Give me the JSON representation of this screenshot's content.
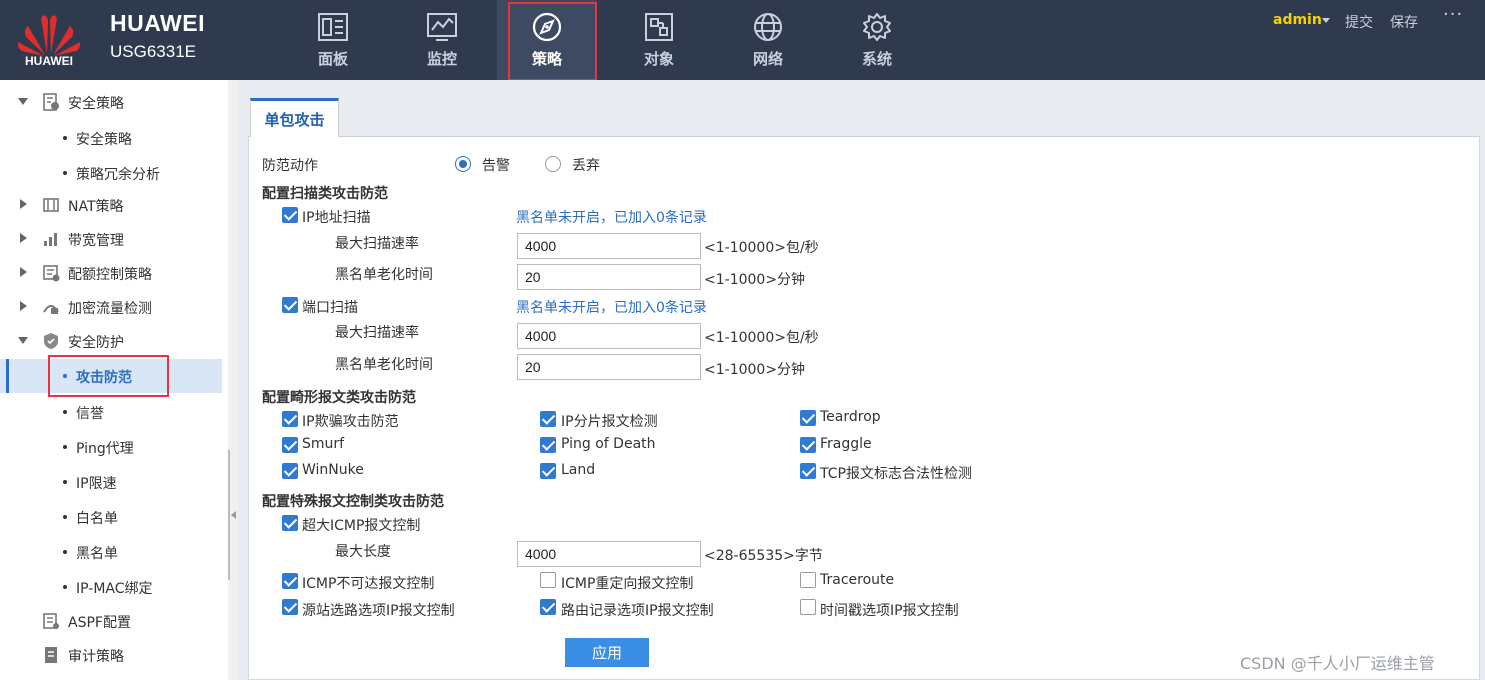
{
  "header": {
    "brand": "HUAWEI",
    "model": "USG6331E",
    "logo_text": "HUAWEI",
    "logo_color": "#e22d2d",
    "nav": [
      {
        "label": "面板",
        "icon": "dashboard-icon"
      },
      {
        "label": "监控",
        "icon": "monitor-chart-icon"
      },
      {
        "label": "策略",
        "icon": "compass-icon",
        "active": true
      },
      {
        "label": "对象",
        "icon": "object-icon"
      },
      {
        "label": "网络",
        "icon": "globe-icon"
      },
      {
        "label": "系统",
        "icon": "gear-icon"
      }
    ],
    "user": "admin",
    "submit": "提交",
    "save": "保存",
    "more": "···"
  },
  "sidebar": {
    "items": [
      {
        "label": "安全策略",
        "level": 0,
        "expanded": true,
        "icon": "security-policy-icon"
      },
      {
        "label": "安全策略",
        "level": 1
      },
      {
        "label": "策略冗余分析",
        "level": 1
      },
      {
        "label": "NAT策略",
        "level": 0,
        "expanded": false,
        "icon": "nat-icon"
      },
      {
        "label": "带宽管理",
        "level": 0,
        "expanded": false,
        "icon": "bandwidth-icon"
      },
      {
        "label": "配额控制策略",
        "level": 0,
        "expanded": false,
        "icon": "quota-icon"
      },
      {
        "label": "加密流量检测",
        "level": 0,
        "expanded": false,
        "icon": "encrypted-traffic-icon"
      },
      {
        "label": "安全防护",
        "level": 0,
        "expanded": true,
        "icon": "shield-icon"
      },
      {
        "label": "攻击防范",
        "level": 1,
        "active": true
      },
      {
        "label": "信誉",
        "level": 1
      },
      {
        "label": "Ping代理",
        "level": 1
      },
      {
        "label": "IP限速",
        "level": 1
      },
      {
        "label": "白名单",
        "level": 1
      },
      {
        "label": "黑名单",
        "level": 1
      },
      {
        "label": "IP-MAC绑定",
        "level": 1
      },
      {
        "label": "ASPF配置",
        "level": 0,
        "icon": "aspf-icon"
      },
      {
        "label": "审计策略",
        "level": 0,
        "icon": "audit-icon"
      }
    ]
  },
  "tab": {
    "label": "单包攻击"
  },
  "form": {
    "action_label": "防范动作",
    "action_options": [
      {
        "label": "告警",
        "checked": true
      },
      {
        "label": "丢弃",
        "checked": false
      }
    ],
    "scan_section": "配置扫描类攻击防范",
    "ip_scan": {
      "label": "IP地址扫描",
      "checked": true,
      "info": "黑名单未开启，已加入0条记录",
      "rate_label": "最大扫描速率",
      "rate_value": "4000",
      "rate_hint": "<1-10000>包/秒",
      "age_label": "黑名单老化时间",
      "age_value": "20",
      "age_hint": "<1-1000>分钟"
    },
    "port_scan": {
      "label": "端口扫描",
      "checked": true,
      "info": "黑名单未开启，已加入0条记录",
      "rate_label": "最大扫描速率",
      "rate_value": "4000",
      "rate_hint": "<1-10000>包/秒",
      "age_label": "黑名单老化时间",
      "age_value": "20",
      "age_hint": "<1-1000>分钟"
    },
    "malformed_section": "配置畸形报文类攻击防范",
    "malformed": [
      {
        "label": "IP欺骗攻击防范",
        "checked": true
      },
      {
        "label": "IP分片报文检测",
        "checked": true
      },
      {
        "label": "Teardrop",
        "checked": true
      },
      {
        "label": "Smurf",
        "checked": true
      },
      {
        "label": "Ping of Death",
        "checked": true
      },
      {
        "label": "Fraggle",
        "checked": true
      },
      {
        "label": "WinNuke",
        "checked": true
      },
      {
        "label": "Land",
        "checked": true
      },
      {
        "label": "TCP报文标志合法性检测",
        "checked": true
      }
    ],
    "special_section": "配置特殊报文控制类攻击防范",
    "icmp_large": {
      "label": "超大ICMP报文控制",
      "checked": true,
      "len_label": "最大长度",
      "len_value": "4000",
      "len_hint": "<28-65535>字节"
    },
    "special": [
      {
        "label": "ICMP不可达报文控制",
        "checked": true
      },
      {
        "label": "ICMP重定向报文控制",
        "checked": false
      },
      {
        "label": "Traceroute",
        "checked": false
      },
      {
        "label": "源站选路选项IP报文控制",
        "checked": true
      },
      {
        "label": "路由记录选项IP报文控制",
        "checked": true
      },
      {
        "label": "时间戳选项IP报文控制",
        "checked": false
      }
    ],
    "apply": "应用"
  },
  "watermark": "CSDN @千人小厂运维主管",
  "colors": {
    "header_bg": "#2f3a4f",
    "accent": "#2a6fc5",
    "highlight_border": "#e8353d",
    "user": "#f5d300"
  }
}
